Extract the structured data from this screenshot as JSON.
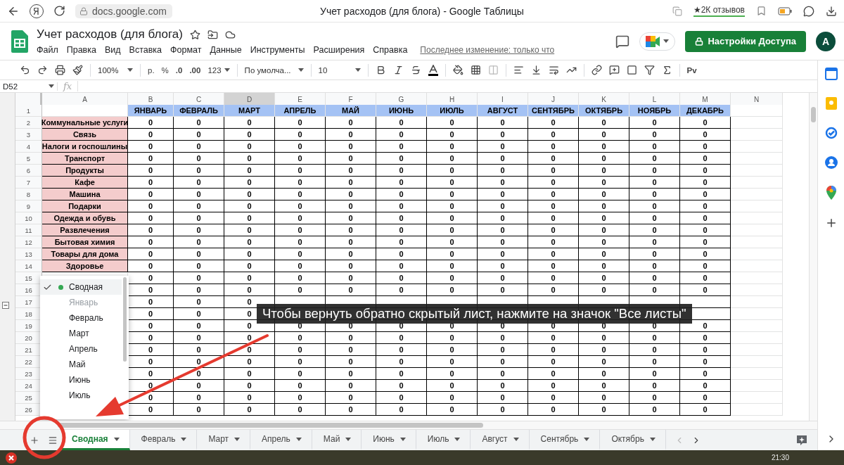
{
  "browser": {
    "url": "docs.google.com",
    "title": "Учет расходов (для блога) - Google Таблицы",
    "reviews": "★2К отзывов"
  },
  "doc": {
    "title": "Учет расходов (для блога)",
    "menus": [
      "Файл",
      "Правка",
      "Вид",
      "Вставка",
      "Формат",
      "Данные",
      "Инструменты",
      "Расширения",
      "Справка"
    ],
    "last_edit": "Последнее изменение: только что",
    "share_button": "Настройки Доступа",
    "avatar": "A"
  },
  "toolbar": {
    "zoom": "100%",
    "currency": "р.",
    "percent": "%",
    "decrease_decimals": ".0",
    "increase_decimals": ".00",
    "number_format": "123",
    "font": "По умолча...",
    "font_size": "10",
    "addon": "Pv"
  },
  "formula_bar": {
    "cell": "D52",
    "fx": "fx"
  },
  "grid": {
    "columns": [
      {
        "label": "A",
        "selected": false
      },
      {
        "label": "B",
        "selected": false
      },
      {
        "label": "C",
        "selected": false
      },
      {
        "label": "D",
        "selected": true
      },
      {
        "label": "E",
        "selected": false
      },
      {
        "label": "F",
        "selected": false
      },
      {
        "label": "G",
        "selected": false
      },
      {
        "label": "H",
        "selected": false
      },
      {
        "label": "I",
        "selected": false
      },
      {
        "label": "J",
        "selected": false
      },
      {
        "label": "K",
        "selected": false
      },
      {
        "label": "L",
        "selected": false
      },
      {
        "label": "M",
        "selected": false
      },
      {
        "label": "N",
        "selected": false
      }
    ],
    "header_row": {
      "number": "1",
      "months": [
        "ЯНВАРЬ",
        "ФЕВРАЛЬ",
        "МАРТ",
        "АПРЕЛЬ",
        "МАЙ",
        "ИЮНЬ",
        "ИЮЛЬ",
        "АВГУСТ",
        "СЕНТЯБРЬ",
        "ОКТЯБРЬ",
        "НОЯБРЬ",
        "ДЕКАБРЬ"
      ]
    },
    "rows": [
      {
        "number": "2",
        "category": "Коммунальные услуги",
        "values": [
          "0",
          "0",
          "0",
          "0",
          "0",
          "0",
          "0",
          "0",
          "0",
          "0",
          "0",
          "0"
        ]
      },
      {
        "number": "3",
        "category": "Связь",
        "values": [
          "0",
          "0",
          "0",
          "0",
          "0",
          "0",
          "0",
          "0",
          "0",
          "0",
          "0",
          "0"
        ]
      },
      {
        "number": "4",
        "category": "Налоги и госпошлины",
        "values": [
          "0",
          "0",
          "0",
          "0",
          "0",
          "0",
          "0",
          "0",
          "0",
          "0",
          "0",
          "0"
        ]
      },
      {
        "number": "5",
        "category": "Транспорт",
        "values": [
          "0",
          "0",
          "0",
          "0",
          "0",
          "0",
          "0",
          "0",
          "0",
          "0",
          "0",
          "0"
        ]
      },
      {
        "number": "6",
        "category": "Продукты",
        "values": [
          "0",
          "0",
          "0",
          "0",
          "0",
          "0",
          "0",
          "0",
          "0",
          "0",
          "0",
          "0"
        ]
      },
      {
        "number": "7",
        "category": "Кафе",
        "values": [
          "0",
          "0",
          "0",
          "0",
          "0",
          "0",
          "0",
          "0",
          "0",
          "0",
          "0",
          "0"
        ]
      },
      {
        "number": "8",
        "category": "Машина",
        "values": [
          "0",
          "0",
          "0",
          "0",
          "0",
          "0",
          "0",
          "0",
          "0",
          "0",
          "0",
          "0"
        ]
      },
      {
        "number": "9",
        "category": "Подарки",
        "values": [
          "0",
          "0",
          "0",
          "0",
          "0",
          "0",
          "0",
          "0",
          "0",
          "0",
          "0",
          "0"
        ]
      },
      {
        "number": "10",
        "category": "Одежда и обувь",
        "values": [
          "0",
          "0",
          "0",
          "0",
          "0",
          "0",
          "0",
          "0",
          "0",
          "0",
          "0",
          "0"
        ]
      },
      {
        "number": "11",
        "category": "Развлечения",
        "values": [
          "0",
          "0",
          "0",
          "0",
          "0",
          "0",
          "0",
          "0",
          "0",
          "0",
          "0",
          "0"
        ]
      },
      {
        "number": "12",
        "category": "Бытовая химия",
        "values": [
          "0",
          "0",
          "0",
          "0",
          "0",
          "0",
          "0",
          "0",
          "0",
          "0",
          "0",
          "0"
        ]
      },
      {
        "number": "13",
        "category": "Товары для дома",
        "values": [
          "0",
          "0",
          "0",
          "0",
          "0",
          "0",
          "0",
          "0",
          "0",
          "0",
          "0",
          "0"
        ]
      },
      {
        "number": "14",
        "category": "Здоровье",
        "values": [
          "0",
          "0",
          "0",
          "0",
          "0",
          "0",
          "0",
          "0",
          "0",
          "0",
          "0",
          "0"
        ]
      },
      {
        "number": "15",
        "values": [
          "0",
          "0",
          "0",
          "0",
          "0",
          "0",
          "0",
          "0",
          "0",
          "0",
          "0",
          "0"
        ]
      },
      {
        "number": "16",
        "values": [
          "0",
          "0",
          "0",
          "0",
          "0",
          "0",
          "0",
          "0",
          "0",
          "0",
          "0",
          "0"
        ]
      },
      {
        "number": "17",
        "values": [
          "0",
          "0",
          "0"
        ]
      },
      {
        "number": "18",
        "values": [
          "0",
          "0",
          "0"
        ]
      },
      {
        "number": "19",
        "values": [
          "0",
          "0",
          "0",
          "0",
          "0",
          "0",
          "0",
          "0",
          "0",
          "0",
          "0",
          "0"
        ]
      },
      {
        "number": "20",
        "values": [
          "0",
          "0",
          "0",
          "0",
          "0",
          "0",
          "0",
          "0",
          "0",
          "0",
          "0",
          "0"
        ]
      },
      {
        "number": "21",
        "values": [
          "0",
          "0",
          "0",
          "0",
          "0",
          "0",
          "0",
          "0",
          "0",
          "0",
          "0",
          "0"
        ]
      },
      {
        "number": "22",
        "values": [
          "0",
          "0",
          "0",
          "0",
          "0",
          "0",
          "0",
          "0",
          "0",
          "0",
          "0",
          "0"
        ]
      },
      {
        "number": "23",
        "values": [
          "0",
          "0",
          "0",
          "0",
          "0",
          "0",
          "0",
          "0",
          "0",
          "0",
          "0",
          "0"
        ]
      },
      {
        "number": "24",
        "values": [
          "0",
          "0",
          "0",
          "0",
          "0",
          "0",
          "0",
          "0",
          "0",
          "0",
          "0",
          "0"
        ]
      },
      {
        "number": "25",
        "values": [
          "0",
          "0",
          "0",
          "0",
          "0",
          "0",
          "0",
          "0",
          "0",
          "0",
          "0",
          "0"
        ]
      },
      {
        "number": "26",
        "values": [
          "0",
          "0",
          "0",
          "0",
          "0",
          "0",
          "0",
          "0",
          "0",
          "0",
          "0",
          "0"
        ]
      }
    ]
  },
  "sheet_menu": {
    "items": [
      {
        "label": "Сводная",
        "selected": true,
        "hidden": false
      },
      {
        "label": "Январь",
        "selected": false,
        "hidden": true
      },
      {
        "label": "Февраль",
        "selected": false,
        "hidden": false
      },
      {
        "label": "Март",
        "selected": false,
        "hidden": false
      },
      {
        "label": "Апрель",
        "selected": false,
        "hidden": false
      },
      {
        "label": "Май",
        "selected": false,
        "hidden": false
      },
      {
        "label": "Июнь",
        "selected": false,
        "hidden": false
      },
      {
        "label": "Июль",
        "selected": false,
        "hidden": false
      }
    ]
  },
  "tooltip": "Чтобы вернуть обратно скрытый лист, нажмите на значок \"Все листы\"",
  "sheet_tabs": [
    {
      "label": "Сводная",
      "selected": true
    },
    {
      "label": "Февраль",
      "selected": false
    },
    {
      "label": "Март",
      "selected": false
    },
    {
      "label": "Апрель",
      "selected": false
    },
    {
      "label": "Май",
      "selected": false
    },
    {
      "label": "Июнь",
      "selected": false
    },
    {
      "label": "Июль",
      "selected": false
    },
    {
      "label": "Август",
      "selected": false
    },
    {
      "label": "Сентябрь",
      "selected": false
    },
    {
      "label": "Октябрь",
      "selected": false
    }
  ],
  "taskbar": {
    "time": "21:30"
  }
}
